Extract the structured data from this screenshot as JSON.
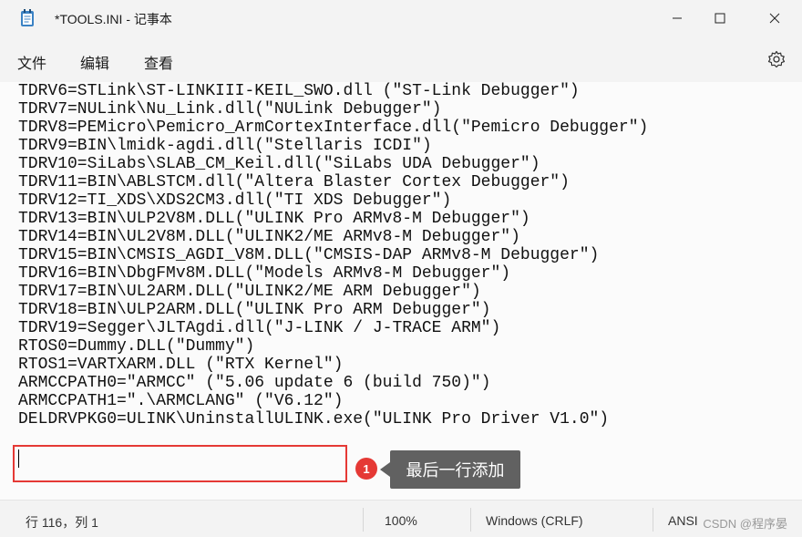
{
  "window": {
    "title": "*TOOLS.INI - 记事本"
  },
  "menu": {
    "file": "文件",
    "edit": "编辑",
    "view": "查看"
  },
  "editor": {
    "lines": [
      "TDRV6=STLink\\ST-LINKIII-KEIL_SWO.dll (\"ST-Link Debugger\")",
      "TDRV7=NULink\\Nu_Link.dll(\"NULink Debugger\")",
      "TDRV8=PEMicro\\Pemicro_ArmCortexInterface.dll(\"Pemicro Debugger\")",
      "TDRV9=BIN\\lmidk-agdi.dll(\"Stellaris ICDI\")",
      "TDRV10=SiLabs\\SLAB_CM_Keil.dll(\"SiLabs UDA Debugger\")",
      "TDRV11=BIN\\ABLSTCM.dll(\"Altera Blaster Cortex Debugger\")",
      "TDRV12=TI_XDS\\XDS2CM3.dll(\"TI XDS Debugger\")",
      "TDRV13=BIN\\ULP2V8M.DLL(\"ULINK Pro ARMv8-M Debugger\")",
      "TDRV14=BIN\\UL2V8M.DLL(\"ULINK2/ME ARMv8-M Debugger\")",
      "TDRV15=BIN\\CMSIS_AGDI_V8M.DLL(\"CMSIS-DAP ARMv8-M Debugger\")",
      "TDRV16=BIN\\DbgFMv8M.DLL(\"Models ARMv8-M Debugger\")",
      "TDRV17=BIN\\UL2ARM.DLL(\"ULINK2/ME ARM Debugger\")",
      "TDRV18=BIN\\ULP2ARM.DLL(\"ULINK Pro ARM Debugger\")",
      "TDRV19=Segger\\JLTAgdi.dll(\"J-LINK / J-TRACE ARM\")",
      "RTOS0=Dummy.DLL(\"Dummy\")",
      "RTOS1=VARTXARM.DLL (\"RTX Kernel\")",
      "ARMCCPATH0=\"ARMCC\" (\"5.06 update 6 (build 750)\")",
      "ARMCCPATH1=\".\\ARMCLANG\" (\"V6.12\")",
      "DELDRVPKG0=ULINK\\UninstallULINK.exe(\"ULINK Pro Driver V1.0\")"
    ]
  },
  "annotation": {
    "badge": "1",
    "tooltip": "最后一行添加",
    "color": "#e53935"
  },
  "status": {
    "position": "行 116，列 1",
    "zoom": "100%",
    "line_ending": "Windows (CRLF)",
    "encoding": "ANSI",
    "watermark": "CSDN @程序晏"
  }
}
